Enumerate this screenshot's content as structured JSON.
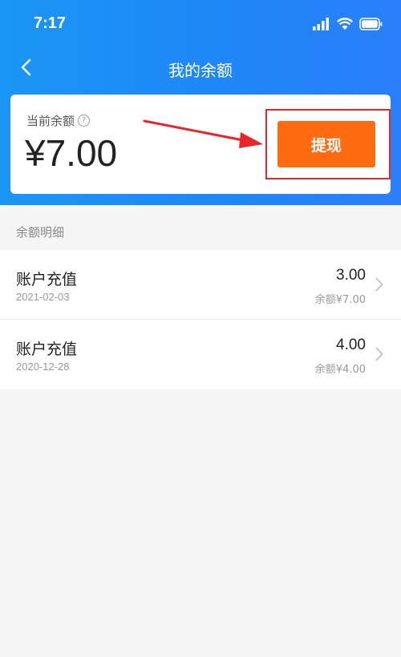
{
  "status_bar": {
    "time": "7:17"
  },
  "nav": {
    "title": "我的余额"
  },
  "balance_card": {
    "label": "当前余额",
    "amount": "¥7.00",
    "withdraw_label": "提现"
  },
  "section": {
    "title": "余额明细"
  },
  "records": [
    {
      "title": "账户充值",
      "date": "2021-02-03",
      "amount": "3.00",
      "balance": "余额¥7.00"
    },
    {
      "title": "账户充值",
      "date": "2020-12-28",
      "amount": "4.00",
      "balance": "余额¥4.00"
    }
  ],
  "colors": {
    "header_blue": "#1f86f7",
    "withdraw_orange": "#ff6b10",
    "annotation_red": "#e6262b"
  },
  "icons": [
    "signal-icon",
    "wifi-icon",
    "battery-icon",
    "back-arrow-icon",
    "help-icon",
    "chevron-right-icon"
  ]
}
